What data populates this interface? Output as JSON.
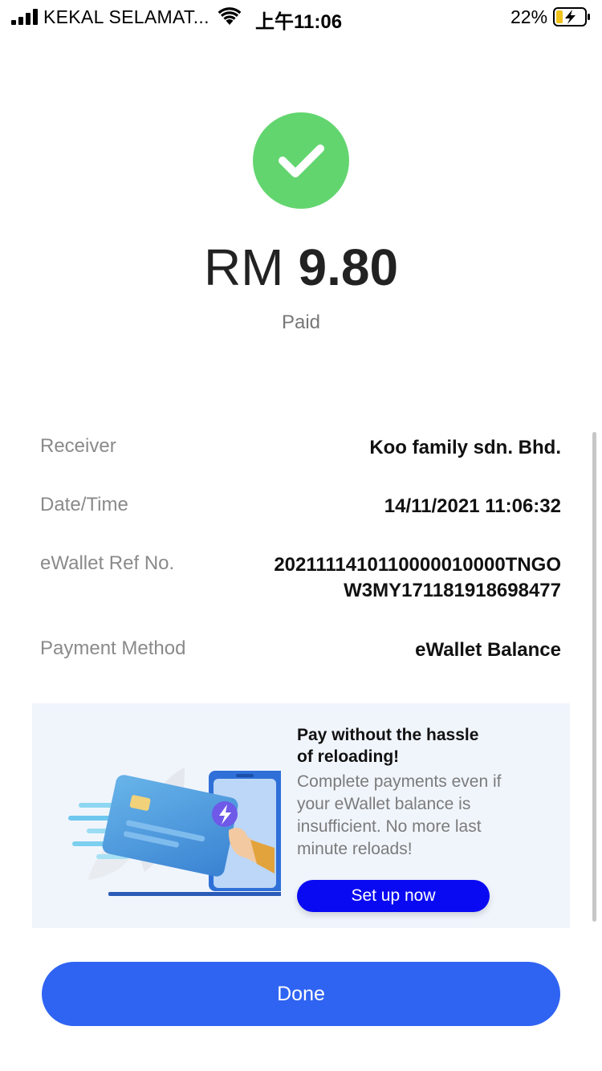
{
  "status_bar": {
    "carrier": "KEKAL SELAMAT...",
    "time": "上午11:06",
    "battery": "22%",
    "icons": [
      "signal-icon",
      "wifi-icon",
      "battery-charging-icon"
    ]
  },
  "result": {
    "icon": "check-icon",
    "currency": "RM",
    "amount": "9.80",
    "status": "Paid"
  },
  "details": [
    {
      "label": "Receiver",
      "value": "Koo family sdn. Bhd."
    },
    {
      "label": "Date/Time",
      "value": "14/11/2021 11:06:32"
    },
    {
      "label": "eWallet Ref No.",
      "value_line1": "2021111410110000010000TNGO",
      "value_line2": "W3MY171181918698477"
    },
    {
      "label": "Payment Method",
      "value": "eWallet Balance"
    }
  ],
  "promo": {
    "title_line1": "Pay without the hassle",
    "title_line2": "of reloading!",
    "body_line1": "Complete payments even if",
    "body_line2": "your eWallet balance is",
    "body_line3": "insufficient. No more last",
    "body_line4": "minute reloads!",
    "button": "Set up now"
  },
  "actions": {
    "done": "Done"
  },
  "colors": {
    "success": "#63d56f",
    "primary": "#2f63f2",
    "promo_button": "#0a0af2",
    "promo_bg": "#f0f5fc"
  }
}
